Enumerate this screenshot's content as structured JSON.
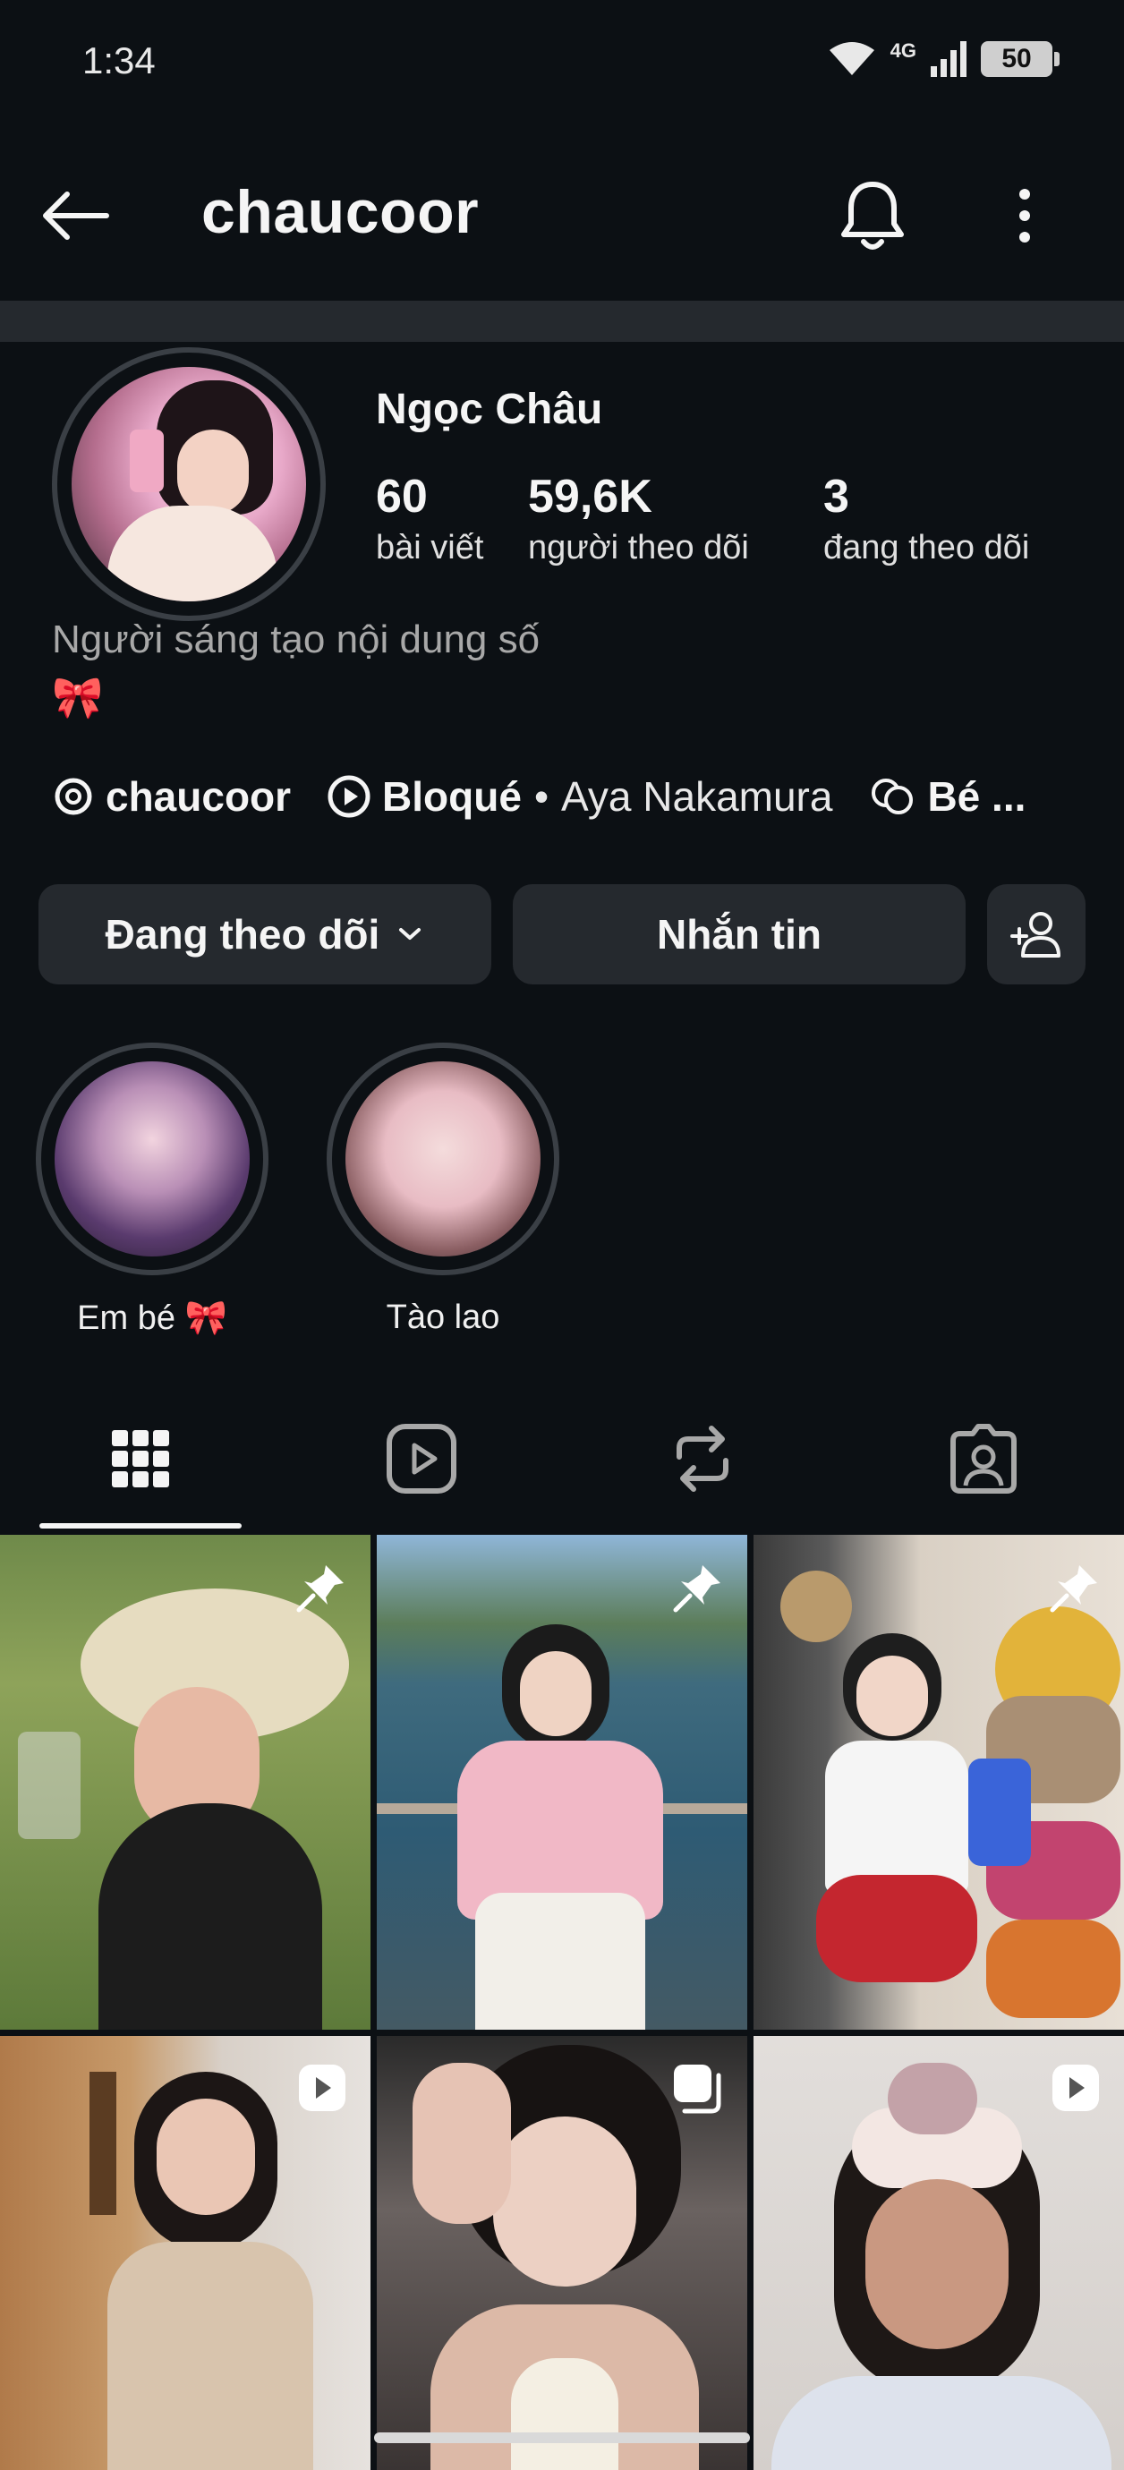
{
  "status_bar": {
    "time": "1:34",
    "network": "4G",
    "battery": "50"
  },
  "header": {
    "username": "chaucoor"
  },
  "profile": {
    "display_name": "Ngọc Châu",
    "stats": [
      {
        "number": "60",
        "label": "bài viết"
      },
      {
        "number": "59,6K",
        "label": "người theo dõi"
      },
      {
        "number": "3",
        "label": "đang theo dõi"
      }
    ],
    "bio": "Người sáng tạo nội dung số",
    "bio_emoji": "🎀",
    "links": {
      "threads_handle": "chaucoor",
      "music_title": "Bloqué",
      "music_separator": "•",
      "music_artist": "Aya Nakamura",
      "channel": "Bé ..."
    }
  },
  "actions": {
    "following_label": "Đang theo dõi",
    "message_label": "Nhắn tin"
  },
  "highlights": [
    {
      "label": "Em bé 🎀"
    },
    {
      "label": "Tào lao"
    }
  ],
  "tabs": [
    "grid-icon",
    "reels-icon",
    "reposts-icon",
    "tagged-icon"
  ],
  "colors": {
    "background": "#0c1014",
    "button": "#25292e",
    "text": "#f5f5f5",
    "muted": "#a8a8a8"
  },
  "posts": [
    {
      "badge": "pin-icon"
    },
    {
      "badge": "pin-icon"
    },
    {
      "badge": "pin-icon"
    },
    {
      "badge": "reel-icon"
    },
    {
      "badge": "carousel-icon"
    },
    {
      "badge": "reel-icon"
    }
  ]
}
